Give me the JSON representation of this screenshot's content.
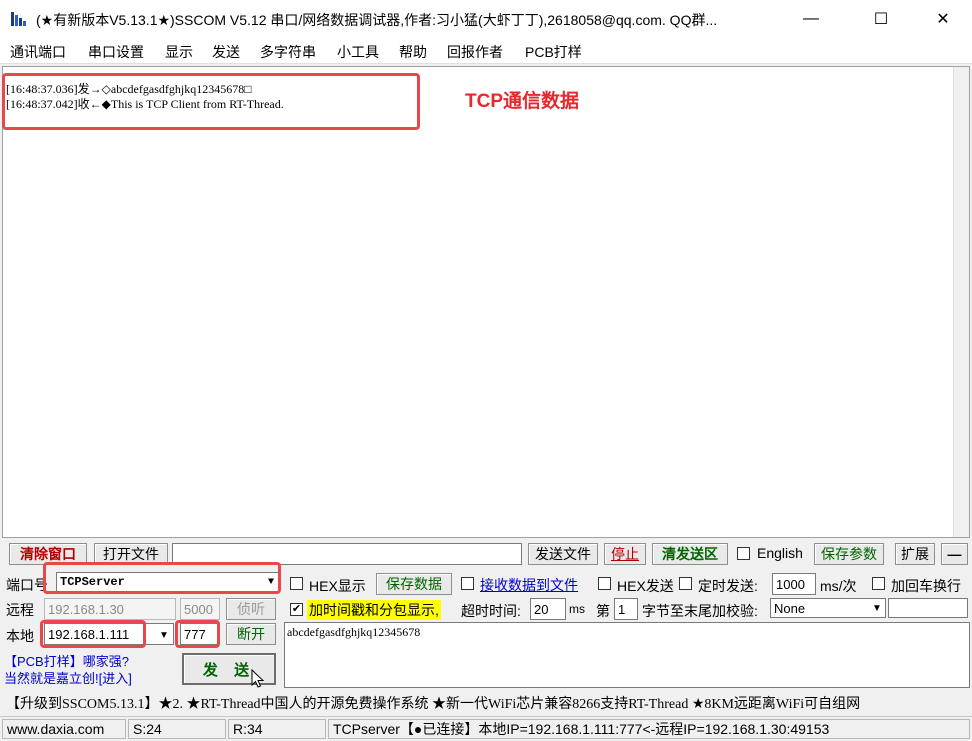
{
  "window": {
    "title": "(★有新版本V5.13.1★)SSCOM V5.12 串口/网络数据调试器,作者:习小猛(大虾丁丁),2618058@qq.com. QQ群...",
    "minimize": "—",
    "maximize": "☐",
    "close": "✕"
  },
  "menu": [
    "通讯端口",
    "串口设置",
    "显示",
    "发送",
    "多字符串",
    "小工具",
    "帮助",
    "回报作者",
    "PCB打样"
  ],
  "receive": {
    "lines": [
      "[16:48:37.036]发→◇abcdefgasdfghjkq12345678□",
      "[16:48:37.042]收←◆This is TCP Client from RT-Thread."
    ],
    "annotation": "TCP通信数据"
  },
  "toolbar": {
    "clear_window": "清除窗口",
    "open_file": "打开文件",
    "file_path": "",
    "send_file": "发送文件",
    "stop": "停止",
    "clear_send": "清发送区",
    "english_label": "English",
    "save_params": "保存参数",
    "expand": "扩展",
    "collapse": "—"
  },
  "connection": {
    "port_label": "端口号",
    "port_value": "TCPServer",
    "remote_label": "远程",
    "remote_ip": "192.168.1.30",
    "remote_port": "5000",
    "listen": "侦听",
    "local_label": "本地",
    "local_ip": "192.168.1.111",
    "local_port": "777",
    "disconnect": "断开"
  },
  "promo": {
    "line1_pre": "【PCB打样】",
    "line1_post": "哪家强?",
    "line2_pre": "当然就是嘉立创!",
    "line2_post": "[进入]"
  },
  "send_button": "发  送",
  "options": {
    "hex_display": "HEX显示",
    "save_data": "保存数据",
    "recv_to_file": "接收数据到文件",
    "timestamp": "加时间戳和分包显示,",
    "timeout_label": "超时时间:",
    "timeout_value": "20",
    "timeout_unit": "ms",
    "hex_send": "HEX发送",
    "timed_send": "定时发送:",
    "interval_value": "1000",
    "interval_unit": "ms/次",
    "append_newline": "加回车换行",
    "nth_label": "第",
    "nth_value": "1",
    "checksum_label": "字节至末尾加校验:",
    "checksum_value": "None"
  },
  "send_text": "abcdefgasdfghjkq12345678",
  "ticker": "【升级到SSCOM5.13.1】★2. ★RT-Thread中国人的开源免费操作系统 ★新一代WiFi芯片兼容8266支持RT-Thread ★8KM远距离WiFi可自组网",
  "status": {
    "site": "www.daxia.com",
    "sent": "S:24",
    "received": "R:34",
    "connection": "TCPserver【●已连接】本地IP=192.168.1.111:777<-远程IP=192.168.1.30:49153"
  },
  "colors": {
    "accent_red": "#e8474b",
    "button_red_text": "#b40000",
    "green_text": "#006400",
    "highlight_yellow": "#ffff00",
    "link_blue": "#0000cc"
  }
}
